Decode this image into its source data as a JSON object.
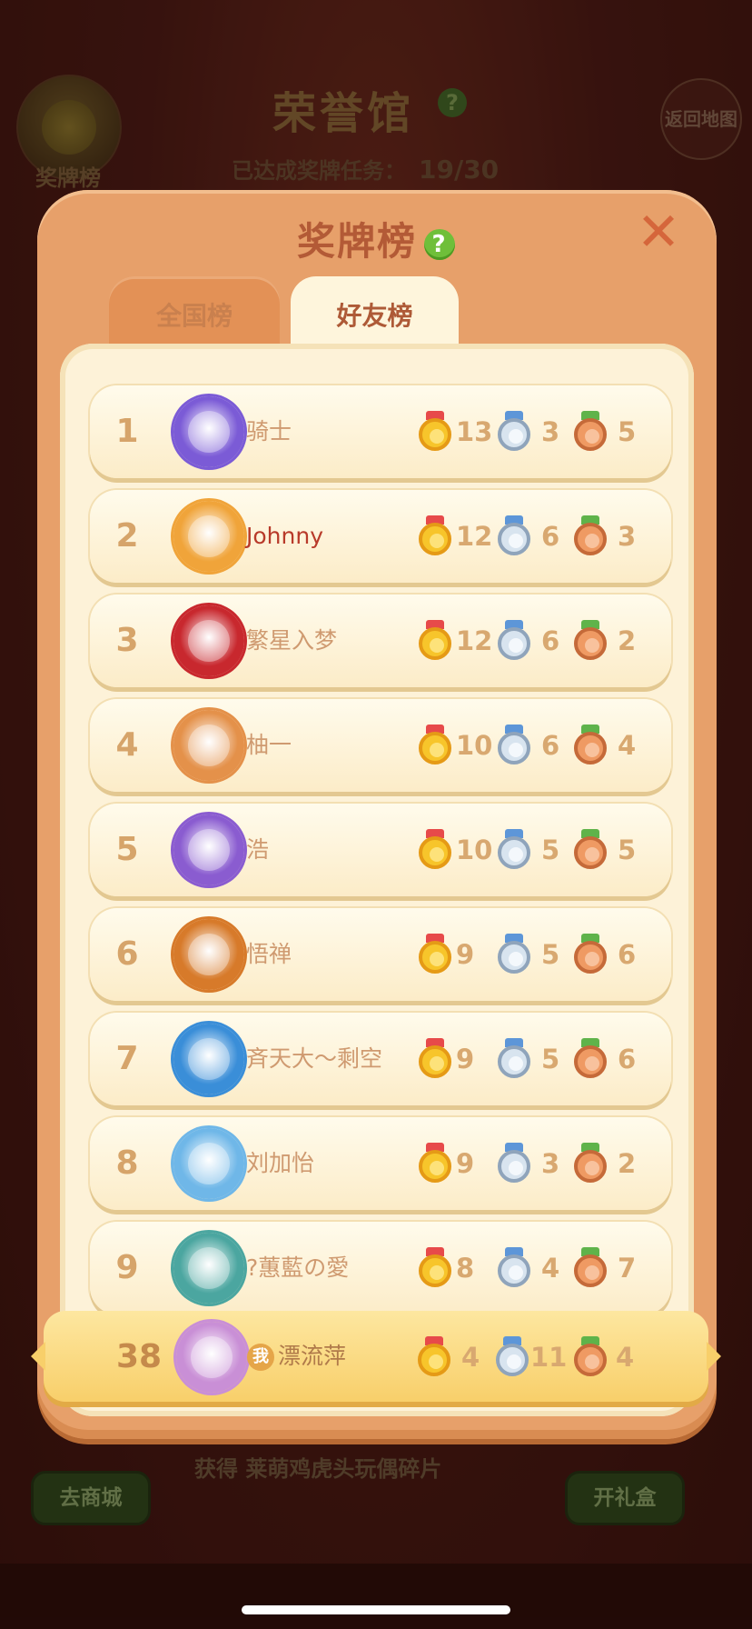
{
  "background": {
    "title": "荣誉馆",
    "help": "?",
    "progress_label": "已达成奖牌任务：",
    "progress_value": "19/30",
    "medal_button_label": "奖牌榜",
    "return_button_label": "返回地图",
    "shop_button_label": "去商城",
    "gift_button_label": "开礼盒",
    "reward_text": "获得 莱萌鸡虎头玩偶碎片"
  },
  "panel": {
    "title": "奖牌榜",
    "help": "?",
    "close": "✕"
  },
  "tabs": [
    {
      "label": "全国榜",
      "active": false
    },
    {
      "label": "好友榜",
      "active": true
    }
  ],
  "rows": [
    {
      "rank": "1",
      "name": "骑士",
      "gold": "13",
      "silver": "3",
      "bronze": "5",
      "avatar_color": "#7b5bd6"
    },
    {
      "rank": "2",
      "name": "Johnny",
      "gold": "12",
      "silver": "6",
      "bronze": "3",
      "avatar_color": "#f0a43a"
    },
    {
      "rank": "3",
      "name": "繁星入梦",
      "gold": "12",
      "silver": "6",
      "bronze": "2",
      "avatar_color": "#c8282e"
    },
    {
      "rank": "4",
      "name": "柚一",
      "gold": "10",
      "silver": "6",
      "bronze": "4",
      "avatar_color": "#e4914a"
    },
    {
      "rank": "5",
      "name": "浩",
      "gold": "10",
      "silver": "5",
      "bronze": "5",
      "avatar_color": "#8a5cd0"
    },
    {
      "rank": "6",
      "name": "悟禅",
      "gold": "9",
      "silver": "5",
      "bronze": "6",
      "avatar_color": "#d77a2a"
    },
    {
      "rank": "7",
      "name": "斉天大～剩空",
      "gold": "9",
      "silver": "5",
      "bronze": "6",
      "avatar_color": "#3a8ed8"
    },
    {
      "rank": "8",
      "name": "刘加怡",
      "gold": "9",
      "silver": "3",
      "bronze": "2",
      "avatar_color": "#6fb7e8"
    },
    {
      "rank": "9",
      "name": "?蕙藍の愛",
      "gold": "8",
      "silver": "4",
      "bronze": "7",
      "avatar_color": "#4ba6a0"
    }
  ],
  "self": {
    "rank": "38",
    "me_label": "我",
    "name": "漂流萍",
    "gold": "4",
    "silver": "11",
    "bronze": "4",
    "avatar_color": "#c98fd6"
  },
  "colors": {
    "panel": "#e7a06a",
    "list_bg": "#fdf2d8",
    "rank_text": "#d6a46a",
    "gold_ribbon": "#e74a4a",
    "silver_ribbon": "#5d96d8",
    "bronze_ribbon": "#5fb34a"
  }
}
